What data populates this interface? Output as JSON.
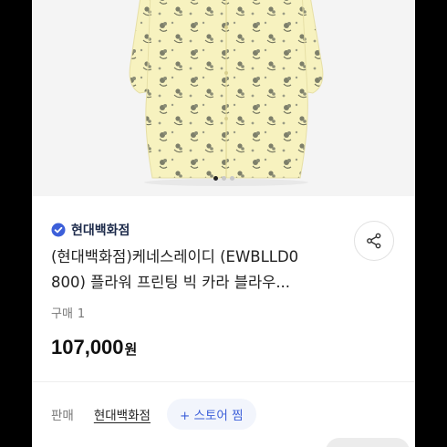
{
  "store": {
    "name": "현대백화점",
    "verified_icon": "check-badge-icon",
    "accent_color": "#3c5fd9"
  },
  "product": {
    "title_line1": "(현대백화점)케네스레이디 (EWBLLD0",
    "title_line2": "800) 플라워 프린팅 빅 카라 블라우...",
    "purchase_label": "구매",
    "purchase_count": "1",
    "price": "107,000",
    "currency": "원"
  },
  "carousel": {
    "total": 3,
    "active_index": 0
  },
  "seller": {
    "label": "판매",
    "name": "현대백화점",
    "zzim_label": "+ 스토어 찜"
  },
  "icons": {
    "share": "share-icon"
  }
}
